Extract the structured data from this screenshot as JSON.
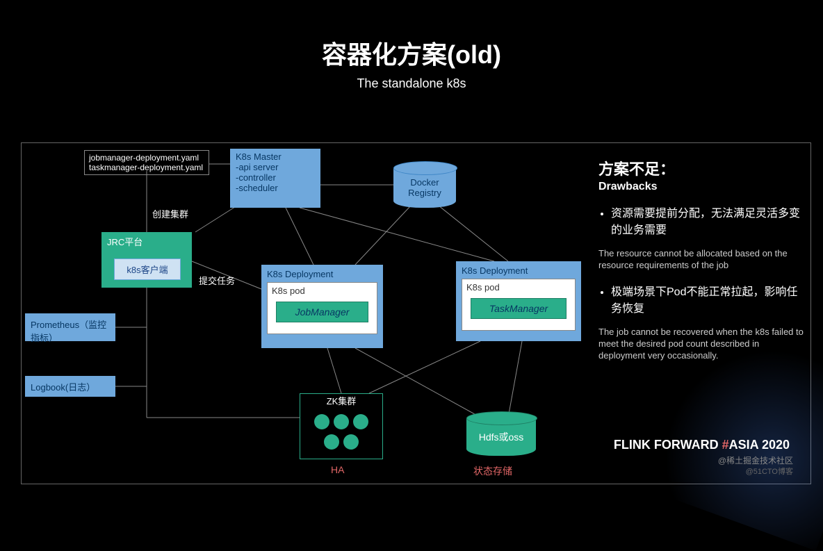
{
  "title": "容器化方案(old)",
  "subtitle": "The standalone k8s",
  "yaml": {
    "line1": "jobmanager-deployment.yaml",
    "line2": "taskmanager-deployment.yaml"
  },
  "k8smaster": {
    "header": "K8s Master",
    "l1": "-api server",
    "l2": "-controller",
    "l3": "-scheduler"
  },
  "docker": {
    "l1": "Docker",
    "l2": "Registry"
  },
  "jrc": {
    "header": "JRC平台",
    "client": "k8s客户端"
  },
  "labels": {
    "create": "创建集群",
    "submit": "提交任务",
    "ha": "HA",
    "store": "状态存储"
  },
  "dep1": {
    "header": "K8s Deployment",
    "pod": "K8s pod",
    "mgr": "JobManager"
  },
  "dep2": {
    "header": "K8s Deployment",
    "pod": "K8s pod",
    "mgr": "TaskManager"
  },
  "prom": "Prometheus（监控指标）",
  "logb": "Logbook(日志）",
  "zk": "ZK集群",
  "hdfs": "Hdfs或oss",
  "right": {
    "h1": "方案不足：",
    "h2": "Drawbacks",
    "b1": "资源需要提前分配，无法满足灵活多变的业务需要",
    "b1en": "The resource cannot be allocated based on the resource requirements of the job",
    "b2": "极端场景下Pod不能正常拉起，影响任务恢复",
    "b2en": "The job cannot be recovered when the k8s failed to meet the desired pod count described in deployment very occasionally."
  },
  "footer": {
    "p1": "FLINK FORWARD",
    "hash": "#",
    "p2": "ASIA 2020"
  },
  "wm1": "@稀土掘金技术社区",
  "wm2": "@51CTO博客"
}
